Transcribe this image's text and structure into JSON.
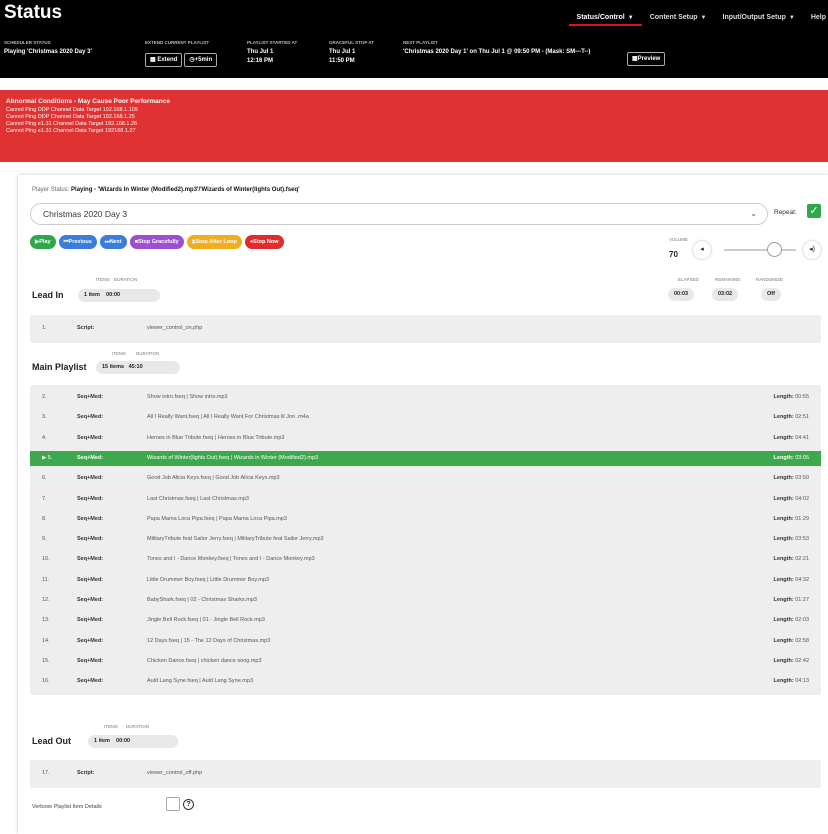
{
  "header": {
    "title": "Status",
    "nav": [
      {
        "label": "Status/Control",
        "active": true
      },
      {
        "label": "Content Setup",
        "active": false
      },
      {
        "label": "Input/Output Setup",
        "active": false
      },
      {
        "label": "Help",
        "active": false
      }
    ],
    "scheduler_status": {
      "label": "SCHEDULER STATUS",
      "value": "Playing 'Christmas 2020 Day 3'"
    },
    "extend": {
      "label": "EXTEND CURRENT PLAYLIST",
      "extend_btn": "Extend",
      "plus_btn": "+5min"
    },
    "playlist_started": {
      "label": "PLAYLIST STARTED AT",
      "line1": "Thu Jul 1",
      "line2": "12:16 PM"
    },
    "graceful_stop": {
      "label": "GRACEFUL STOP AT",
      "line1": "Thu Jul 1",
      "line2": "11:50 PM"
    },
    "next_playlist": {
      "label": "NEXT PLAYLIST",
      "value": "'Christmas 2020 Day 1' on Thu Jul 1 @ 09:50 PM - (Mask: SM---T--)",
      "preview_btn": "Preview"
    }
  },
  "alert": {
    "title": "Abnormal Conditions - May Cause Poor Performance",
    "lines": [
      "Cannot Ping DDP Channel Data Target 192.168.1.105",
      "Cannot Ping DDP Channel Data Target 192.168.1.25",
      "Cannot Ping e1.31 Channel Data Target 192.168.1.26",
      "Cannot Ping e1.31 Channel Data Target 192168.1.27"
    ]
  },
  "player": {
    "status_label": "Player Status:",
    "status_value": "Playing - 'Wizards In Winter (Modified2).mp3'/'Wizards of Winter(lights Out).fseq'",
    "playlist_select": "Christmas 2020 Day 3",
    "repeat_label": "Repeat:",
    "buttons": [
      {
        "icon": "▶",
        "label": "Play",
        "color": "#2ea84a"
      },
      {
        "icon": "⏮",
        "label": "Previous",
        "color": "#3b7ddd"
      },
      {
        "icon": "⏭",
        "label": "Next",
        "color": "#3b7ddd"
      },
      {
        "icon": "■",
        "label": "Stop Gracefully",
        "color": "#9b4fd1"
      },
      {
        "icon": "⧗",
        "label": "Stop After Loop",
        "color": "#f0ad1e"
      },
      {
        "icon": "●",
        "label": "Stop Now",
        "color": "#e02c2c"
      }
    ],
    "volume_label": "VOLUME",
    "volume_value": "70",
    "volume_level": 0.7,
    "elapsed_label": "ELAPSED",
    "elapsed": "00:03",
    "remaining_label": "REMAINING",
    "remaining": "03:02",
    "randomize_label": "RANDOMIZE",
    "randomize": "Off"
  },
  "lead_in": {
    "title": "Lead In",
    "items_label": "ITEMS",
    "items": "1 item",
    "duration_label": "DURATION",
    "duration": "00:00",
    "rows": [
      {
        "num": "1.",
        "type": "Script:",
        "name": "viewer_control_on.php",
        "len": ""
      }
    ]
  },
  "main_playlist": {
    "title": "Main Playlist",
    "items_label": "ITEMS",
    "items": "15 items",
    "duration_label": "DURATION",
    "duration": "45:10",
    "length_label": "Length:",
    "rows": [
      {
        "num": "2.",
        "type": "Seq+Med:",
        "name": "Show intro.fseq | Show intro.mp3",
        "len": "00:55"
      },
      {
        "num": "3.",
        "type": "Seq+Med:",
        "name": "All I Really Want.fseq | All I Really Want For Christmas lil Jon .m4a",
        "len": "02:51"
      },
      {
        "num": "4.",
        "type": "Seq+Med:",
        "name": "Heroes in Blue Tribute.fseq | Heroes in Blue Tribute.mp3",
        "len": "04:41"
      },
      {
        "num": "▶ 5.",
        "type": "Seq+Med:",
        "name": "Wizards of Winter(lights Out).fseq | Wizards in Winter (Modified2).mp3",
        "len": "03:05",
        "active": true
      },
      {
        "num": "6.",
        "type": "Seq+Med:",
        "name": "Good Job Alicia Keys.fseq | Good Job Alicia Keys.mp3",
        "len": "03:50"
      },
      {
        "num": "7.",
        "type": "Seq+Med:",
        "name": "Last Christmas.fseq | Last Christmas.mp3",
        "len": "04:02"
      },
      {
        "num": "8.",
        "type": "Seq+Med:",
        "name": "Papa Mama Loca Pipa.fseq | Papa Mama Loca Pipa.mp3",
        "len": "01:29"
      },
      {
        "num": "9.",
        "type": "Seq+Med:",
        "name": "MilitaryTribute feat Sailor Jerry.fseq | MilitaryTribute feat Sailor Jerry.mp3",
        "len": "03:53"
      },
      {
        "num": "10.",
        "type": "Seq+Med:",
        "name": "Tones and I - Dance Monkey.fseq | Tones and I - Dance Monkey.mp3",
        "len": "02:21"
      },
      {
        "num": "11.",
        "type": "Seq+Med:",
        "name": "Little Drummer Boy.fseq | Little Drummer Boy.mp3",
        "len": "04:32"
      },
      {
        "num": "12.",
        "type": "Seq+Med:",
        "name": "BabyShark.fseq | 03 - Christmas Sharks.mp3",
        "len": "01:27"
      },
      {
        "num": "13.",
        "type": "Seq+Med:",
        "name": "Jingle Bell Rock.fseq | 01 - Jingle Bell Rock.mp3",
        "len": "02:03"
      },
      {
        "num": "14.",
        "type": "Seq+Med:",
        "name": "12 Days.fseq | 15 - The 12 Days of Christmas.mp3",
        "len": "02:58"
      },
      {
        "num": "15.",
        "type": "Seq+Med:",
        "name": "Chicken Dance.fseq | chicken dance song.mp3",
        "len": "02:42"
      },
      {
        "num": "16.",
        "type": "Seq+Med:",
        "name": "Auld Lang Syne.fseq | Auld Lang Syne.mp3",
        "len": "04:13"
      }
    ]
  },
  "lead_out": {
    "title": "Lead Out",
    "items_label": "ITEMS",
    "items": "1 item",
    "duration_label": "DURATION",
    "duration": "00:00",
    "rows": [
      {
        "num": "17.",
        "type": "Script:",
        "name": "viewer_control_off.php",
        "len": ""
      }
    ]
  },
  "verbose": {
    "label": "Verbose Playlist Item Details",
    "help_icon": "?"
  }
}
